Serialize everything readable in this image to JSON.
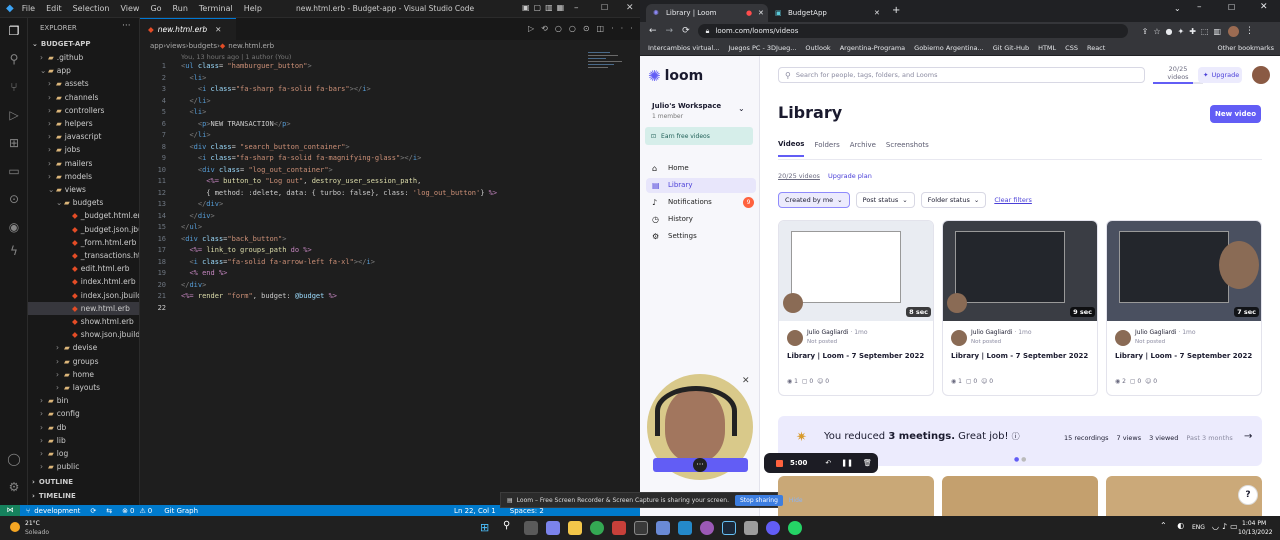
{
  "vscode": {
    "title": "new.html.erb - Budget-app - Visual Studio Code",
    "menu": [
      "File",
      "Edit",
      "Selection",
      "View",
      "Go",
      "Run",
      "Terminal",
      "Help"
    ],
    "explorer_title": "EXPLORER",
    "project": "BUDGET-APP",
    "tree": [
      {
        "label": ".github",
        "depth": 1,
        "type": "folder",
        "arrow": "›"
      },
      {
        "label": "app",
        "depth": 1,
        "type": "folder",
        "arrow": "⌄"
      },
      {
        "label": "assets",
        "depth": 2,
        "type": "folder",
        "arrow": "›"
      },
      {
        "label": "channels",
        "depth": 2,
        "type": "folder",
        "arrow": "›"
      },
      {
        "label": "controllers",
        "depth": 2,
        "type": "folder",
        "arrow": "›"
      },
      {
        "label": "helpers",
        "depth": 2,
        "type": "folder",
        "arrow": "›"
      },
      {
        "label": "javascript",
        "depth": 2,
        "type": "folder",
        "arrow": "›"
      },
      {
        "label": "jobs",
        "depth": 2,
        "type": "folder",
        "arrow": "›"
      },
      {
        "label": "mailers",
        "depth": 2,
        "type": "folder",
        "arrow": "›"
      },
      {
        "label": "models",
        "depth": 2,
        "type": "folder",
        "arrow": "›"
      },
      {
        "label": "views",
        "depth": 2,
        "type": "folder",
        "arrow": "⌄"
      },
      {
        "label": "budgets",
        "depth": 3,
        "type": "folder",
        "arrow": "⌄"
      },
      {
        "label": "_budget.html.erb",
        "depth": 4,
        "type": "file"
      },
      {
        "label": "_budget.json.jbu...",
        "depth": 4,
        "type": "file"
      },
      {
        "label": "_form.html.erb",
        "depth": 4,
        "type": "file"
      },
      {
        "label": "_transactions.ht...",
        "depth": 4,
        "type": "file"
      },
      {
        "label": "edit.html.erb",
        "depth": 4,
        "type": "file"
      },
      {
        "label": "index.html.erb",
        "depth": 4,
        "type": "file"
      },
      {
        "label": "index.json.jbuilder",
        "depth": 4,
        "type": "file"
      },
      {
        "label": "new.html.erb",
        "depth": 4,
        "type": "file",
        "selected": true
      },
      {
        "label": "show.html.erb",
        "depth": 4,
        "type": "file"
      },
      {
        "label": "show.json.jbuilder",
        "depth": 4,
        "type": "file"
      },
      {
        "label": "devise",
        "depth": 3,
        "type": "folder",
        "arrow": "›"
      },
      {
        "label": "groups",
        "depth": 3,
        "type": "folder",
        "arrow": "›"
      },
      {
        "label": "home",
        "depth": 3,
        "type": "folder",
        "arrow": "›"
      },
      {
        "label": "layouts",
        "depth": 3,
        "type": "folder",
        "arrow": "›"
      },
      {
        "label": "bin",
        "depth": 1,
        "type": "folder",
        "arrow": "›"
      },
      {
        "label": "config",
        "depth": 1,
        "type": "folder",
        "arrow": "›"
      },
      {
        "label": "db",
        "depth": 1,
        "type": "folder",
        "arrow": "›"
      },
      {
        "label": "lib",
        "depth": 1,
        "type": "folder",
        "arrow": "›"
      },
      {
        "label": "log",
        "depth": 1,
        "type": "folder",
        "arrow": "›"
      },
      {
        "label": "public",
        "depth": 1,
        "type": "folder",
        "arrow": "›"
      }
    ],
    "outline": "OUTLINE",
    "timeline": "TIMELINE",
    "tab": "new.html.erb",
    "breadcrumb": [
      "app",
      "views",
      "budgets",
      "new.html.erb"
    ],
    "blame": "You, 13 hours ago | 1 author (You)",
    "code": [
      "<ul class= \"hamburguer_button\">",
      "  <li>",
      "    <i class=\"fa-sharp fa-solid fa-bars\"></i>",
      "  </li>",
      "  <li>",
      "    <p>NEW TRANSACTION</p>",
      "  </li>",
      "  <div class= \"search_button_container\">",
      "    <i class=\"fa-sharp fa-solid fa-magnifying-glass\"></i>",
      "    <div class= \"log_out_container\">",
      "      <%= button_to \"Log out\", destroy_user_session_path,",
      "      { method: :delete, data: { turbo: false}, class: 'log_out_button'} %>",
      "    </div>",
      "  </div>",
      "</ul>",
      "<div class=\"back_button\">",
      "  <%= link_to groups_path do %>",
      "  <i class=\"fa-solid fa-arrow-left fa-xl\"></i>",
      "  <% end %>",
      "</div>",
      "<%= render \"form\", budget: @budget %>",
      ""
    ],
    "status": {
      "branch": "development",
      "problems": "0",
      "warnings": "0",
      "git_graph": "Git Graph",
      "position": "Ln 22, Col 1",
      "spaces": "Spaces: 2"
    }
  },
  "browser": {
    "tabs": [
      {
        "label": "Library | Loom",
        "active": true
      },
      {
        "label": "BudgetApp",
        "active": false
      }
    ],
    "url": "loom.com/looms/videos",
    "bookmarks": [
      "Intercambios virtual...",
      "Juegos PC - 3DJueg...",
      "Outlook",
      "Argentina-Programa",
      "Gobierno Argentina...",
      "Git Git-Hub",
      "HTML",
      "CSS",
      "React",
      "Other bookmarks"
    ]
  },
  "loom": {
    "brand": "loom",
    "workspace": "Julio's Workspace",
    "members": "1 member",
    "earn": "Earn free videos",
    "nav": [
      {
        "label": "Home",
        "icon": "home-icon",
        "glyph": "⌂"
      },
      {
        "label": "Library",
        "icon": "library-icon",
        "glyph": "▤",
        "selected": true
      },
      {
        "label": "Notifications",
        "icon": "bell-icon",
        "glyph": "♪",
        "badge": "9"
      },
      {
        "label": "History",
        "icon": "history-icon",
        "glyph": "◷"
      },
      {
        "label": "Settings",
        "icon": "settings-icon",
        "glyph": "⚙"
      }
    ],
    "search_placeholder": "Search for people, tags, folders, and Looms",
    "quota": "20/25",
    "quota_unit": "videos",
    "upgrade": "Upgrade",
    "page_title": "Library",
    "new_video": "New video",
    "tabs": [
      "Videos",
      "Folders",
      "Archive",
      "Screenshots"
    ],
    "videos_count": "20/25 videos",
    "upgrade_plan": "Upgrade plan",
    "filters": [
      "Created by me",
      "Post status",
      "Folder status"
    ],
    "clear_filters": "Clear filters",
    "cards": [
      {
        "duration": "8 sec",
        "author": "Julio Gagliardi",
        "age": "· 1mo",
        "status": "Not posted",
        "title": "Library | Loom - 7 September 2022",
        "views": "1",
        "comments": "0",
        "reactions": "0"
      },
      {
        "duration": "9 sec",
        "author": "Julio Gagliardi",
        "age": "· 1mo",
        "status": "Not posted",
        "title": "Library | Loom - 7 September 2022",
        "views": "1",
        "comments": "0",
        "reactions": "0"
      },
      {
        "duration": "7 sec",
        "author": "Julio Gagliardi",
        "age": "· 1mo",
        "status": "Not posted",
        "title": "Library | Loom - 7 September 2022",
        "views": "2",
        "comments": "0",
        "reactions": "0"
      }
    ],
    "banner": {
      "pre": "You reduced ",
      "bold": "3 meetings.",
      "post": " Great job!",
      "recordings": "15 recordings",
      "views": "7 views",
      "viewed": "3 viewed",
      "period": "Past 3 months"
    },
    "recorder_time": "5:00",
    "share_notice": "Loom – Free Screen Recorder & Screen Capture is sharing your screen.",
    "stop_sharing": "Stop sharing",
    "hide": "Hide",
    "help": "?"
  },
  "taskbar": {
    "temp": "21°C",
    "weather": "Soleado",
    "lang": "ENG",
    "time": "1:04 PM",
    "date": "10/13/2022"
  },
  "colors": {
    "vscode_blue": "#007acc",
    "loom_purple": "#625df5",
    "recording_red": "#ff623e"
  }
}
